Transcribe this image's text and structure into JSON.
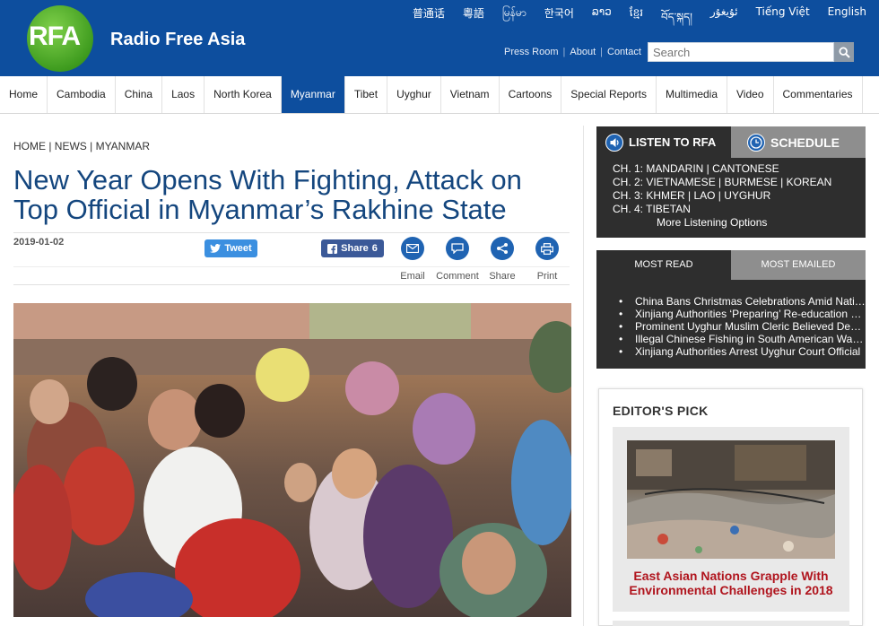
{
  "header": {
    "logo_text": "RFA",
    "brand": "Radio Free Asia",
    "languages": [
      "普通话",
      "粵語",
      "မြန်မာ",
      "한국어",
      "ລາວ",
      "ខ្មែរ",
      "བོད་སྐད།",
      "ئۇيغۇر",
      "Tiếng Việt",
      "English"
    ],
    "toplinks": [
      "Press Room",
      "About",
      "Contact"
    ],
    "search_placeholder": "Search"
  },
  "nav": {
    "items": [
      "Home",
      "Cambodia",
      "China",
      "Laos",
      "North Korea",
      "Myanmar",
      "Tibet",
      "Uyghur",
      "Vietnam",
      "Cartoons",
      "Special Reports",
      "Multimedia",
      "Video",
      "Commentaries"
    ],
    "active": "Myanmar"
  },
  "article": {
    "breadcrumb": "HOME | NEWS | MYANMAR",
    "title": "New Year Opens With Fighting, Attack on Top Official in Myanmar’s Rakhine State",
    "date": "2019-01-02",
    "tweet_label": "Tweet",
    "share_label": "Share",
    "share_count": "6",
    "actions": [
      "Email",
      "Comment",
      "Share",
      "Print"
    ]
  },
  "listen": {
    "tab_listen": "LISTEN TO RFA",
    "tab_schedule": "SCHEDULE",
    "channels": [
      "CH. 1: MANDARIN | CANTONESE",
      "CH. 2: VIETNAMESE | BURMESE | KOREAN",
      "CH. 3: KHMER | LAO | UYGHUR",
      "CH. 4: TIBETAN"
    ],
    "more": "More Listening Options"
  },
  "most": {
    "tab_read": "MOST READ",
    "tab_emailed": "MOST EMAILED",
    "items": [
      "China Bans Christmas Celebrations Amid National Crackdown",
      "Xinjiang Authorities ‘Preparing’ Re-education Camp Detainees",
      "Prominent Uyghur Muslim Cleric Believed Dead in Detention",
      "Illegal Chinese Fishing in South American Waters",
      "Xinjiang Authorities Arrest Uyghur Court Official"
    ]
  },
  "editors_pick": {
    "title": "EDITOR'S PICK",
    "caption": "East Asian Nations Grapple With Environmental Challenges in 2018"
  },
  "colors": {
    "brand_blue": "#0d4e9e",
    "title_blue": "#14467e",
    "sidebar_dark": "#2e2e2e",
    "accent_red": "#b0141d"
  }
}
